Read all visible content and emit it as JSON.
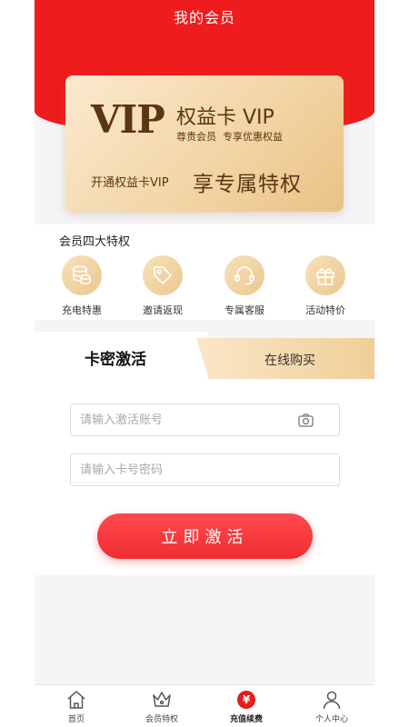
{
  "header": {
    "title": "我的会员"
  },
  "vip_card": {
    "logo": "VIP",
    "title": "权益卡 VIP",
    "subtitle": "尊贵会员  专享优惠权益",
    "open_text": "开通权益卡VIP",
    "privilege_text": "享专属特权"
  },
  "benefits": {
    "title": "会员四大特权",
    "items": [
      {
        "label": "充电特惠",
        "icon": "coins-icon"
      },
      {
        "label": "邀请返现",
        "icon": "tag-icon"
      },
      {
        "label": "专属客服",
        "icon": "headset-icon"
      },
      {
        "label": "活动特价",
        "icon": "gift-icon"
      }
    ]
  },
  "activation": {
    "tab_active": "卡密激活",
    "tab_other": "在线购买",
    "account_placeholder": "请输入激活账号",
    "password_placeholder": "请输入卡号密码",
    "submit_label": "立即激活"
  },
  "tabbar": {
    "items": [
      {
        "label": "首页",
        "icon": "home-icon"
      },
      {
        "label": "会员特权",
        "icon": "crown-icon"
      },
      {
        "label": "充值续费",
        "icon": "yen-icon",
        "glyph": "¥"
      },
      {
        "label": "个人中心",
        "icon": "user-icon"
      }
    ]
  },
  "colors": {
    "brand_red": "#ee1c1c",
    "gold": "#ecc78e",
    "gold_text": "#5b3612"
  }
}
